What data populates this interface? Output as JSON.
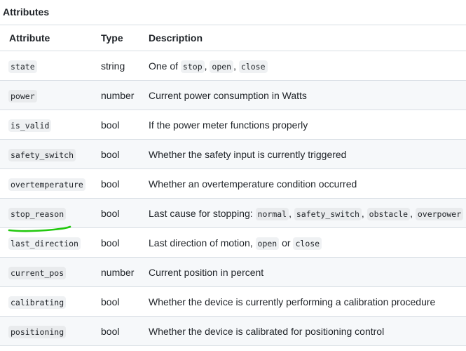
{
  "title": "Attributes",
  "columns": {
    "attribute": "Attribute",
    "type": "Type",
    "description": "Description"
  },
  "rows": [
    {
      "attribute": "state",
      "type": "string",
      "desc_prefix": "One of ",
      "codes": [
        "stop",
        "open",
        "close"
      ],
      "sep": ", ",
      "desc_suffix": ""
    },
    {
      "attribute": "power",
      "type": "number",
      "desc_prefix": "Current power consumption in Watts",
      "codes": [],
      "sep": "",
      "desc_suffix": ""
    },
    {
      "attribute": "is_valid",
      "type": "bool",
      "desc_prefix": "If the power meter functions properly",
      "codes": [],
      "sep": "",
      "desc_suffix": ""
    },
    {
      "attribute": "safety_switch",
      "type": "bool",
      "desc_prefix": "Whether the safety input is currently triggered",
      "codes": [],
      "sep": "",
      "desc_suffix": ""
    },
    {
      "attribute": "overtemperature",
      "type": "bool",
      "desc_prefix": "Whether an overtemperature condition occurred",
      "codes": [],
      "sep": "",
      "desc_suffix": ""
    },
    {
      "attribute": "stop_reason",
      "type": "bool",
      "desc_prefix": "Last cause for stopping: ",
      "codes": [
        "normal",
        "safety_switch",
        "obstacle",
        "overpower"
      ],
      "sep": ", ",
      "desc_suffix": ""
    },
    {
      "attribute": "last_direction",
      "type": "bool",
      "desc_prefix": "Last direction of motion, ",
      "codes": [
        "open",
        "close"
      ],
      "sep": " or ",
      "desc_suffix": ""
    },
    {
      "attribute": "current_pos",
      "type": "number",
      "desc_prefix": "Current position in percent",
      "codes": [],
      "sep": "",
      "desc_suffix": ""
    },
    {
      "attribute": "calibrating",
      "type": "bool",
      "desc_prefix": "Whether the device is currently performing a calibration procedure",
      "codes": [],
      "sep": "",
      "desc_suffix": ""
    },
    {
      "attribute": "positioning",
      "type": "bool",
      "desc_prefix": "Whether the device is calibrated for positioning control",
      "codes": [],
      "sep": "",
      "desc_suffix": ""
    }
  ],
  "colors": {
    "border": "#d8dee4",
    "stripe": "#f6f8fa",
    "code_bg": "#eff1f3",
    "annotation": "#22c80e"
  }
}
